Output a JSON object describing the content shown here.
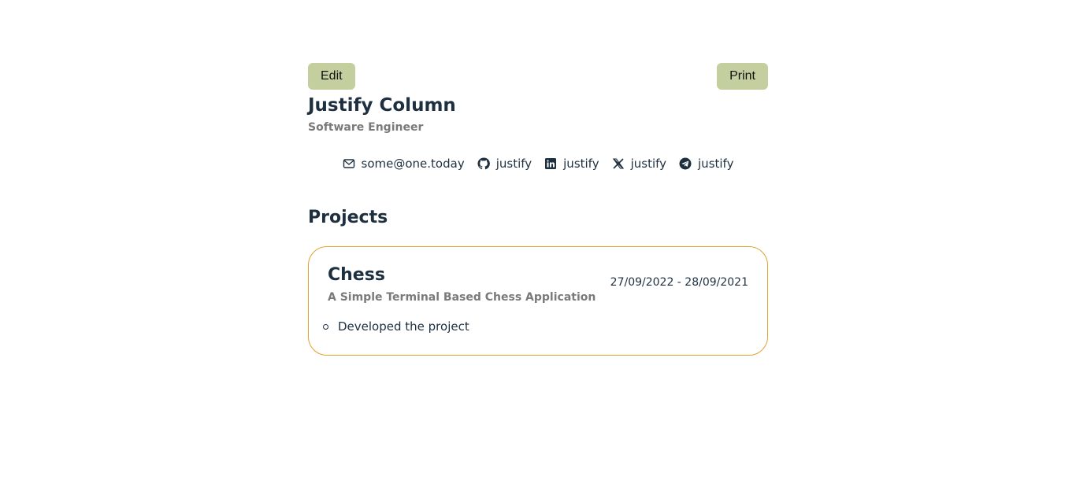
{
  "toolbar": {
    "edit_label": "Edit",
    "print_label": "Print"
  },
  "profile": {
    "name": "Justify Column",
    "role": "Software Engineer"
  },
  "contacts": [
    {
      "icon": "mail-icon",
      "text": "some@one.today"
    },
    {
      "icon": "github-icon",
      "text": "justify"
    },
    {
      "icon": "linkedin-icon",
      "text": "justify"
    },
    {
      "icon": "x-icon",
      "text": "justify"
    },
    {
      "icon": "telegram-icon",
      "text": "justify"
    }
  ],
  "projects": {
    "title": "Projects",
    "items": [
      {
        "name": "Chess",
        "description": "A Simple Terminal Based Chess Application",
        "dates": "27/09/2022 - 28/09/2021",
        "bullets": [
          "Developed the project"
        ]
      }
    ]
  },
  "colors": {
    "button_bg": "#c3cf9f",
    "text_dark": "#1e3040",
    "text_muted": "#7a7a7a",
    "card_border": "#e0a231"
  }
}
